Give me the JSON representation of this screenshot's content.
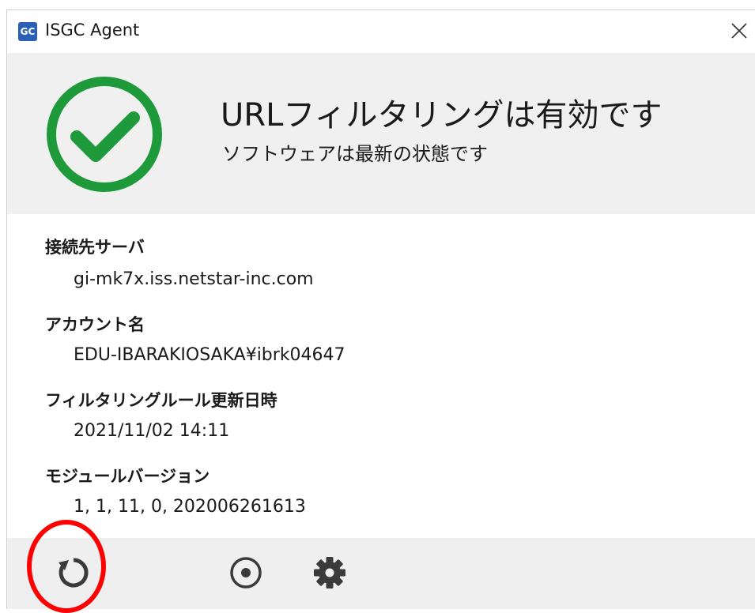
{
  "window": {
    "title": "ISGC Agent",
    "app_icon_text": "GC",
    "close_icon": "close-icon"
  },
  "status": {
    "title": "URLフィルタリングは有効です",
    "subtitle": "ソフトウェアは最新の状態です",
    "icon": "check-circle-icon",
    "color": "#1f9a3a"
  },
  "info": {
    "server_label": "接続先サーバ",
    "server_value": "gi-mk7x.iss.netstar-inc.com",
    "account_label": "アカウント名",
    "account_value": "EDU-IBARAKIOSAKA¥ibrk04647",
    "rule_updated_label": "フィルタリングルール更新日時",
    "rule_updated_value": "2021/11/02 14:11",
    "module_version_label": "モジュールバージョン",
    "module_version_value": "1, 1, 11, 0, 202006261613"
  },
  "footer": {
    "buttons": [
      {
        "icon": "refresh-icon"
      },
      {
        "icon": "stop-record-icon"
      },
      {
        "icon": "gear-icon"
      }
    ],
    "highlight_color": "#ff0000"
  }
}
